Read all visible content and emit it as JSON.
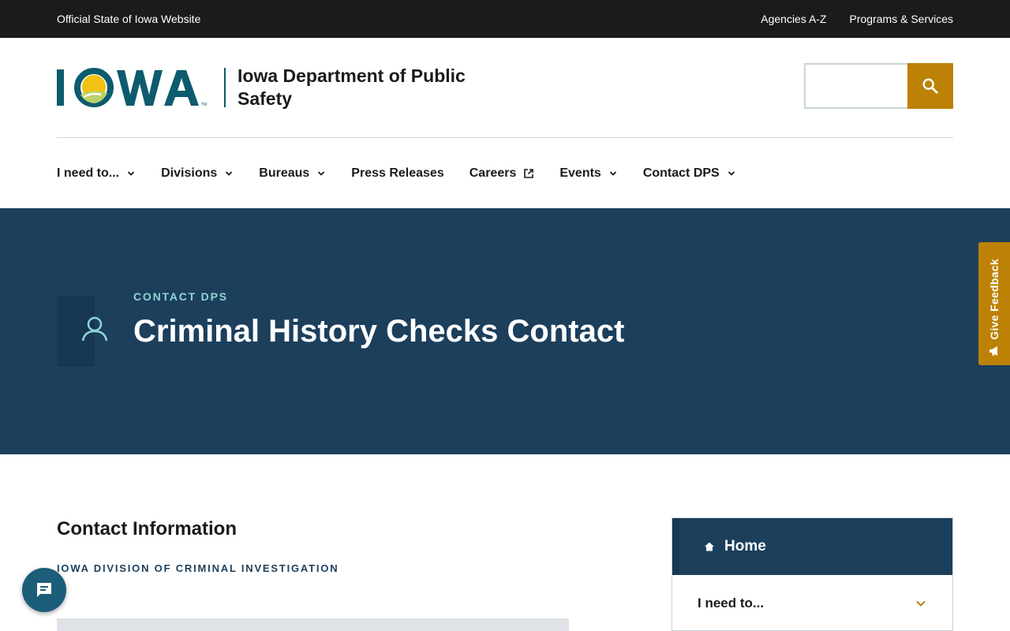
{
  "topbar": {
    "official_label": "Official State of Iowa Website",
    "links": [
      "Agencies A-Z",
      "Programs & Services"
    ]
  },
  "header": {
    "logo_text": "IOWA",
    "department_name": "Iowa Department of Public Safety",
    "search": {
      "placeholder": "",
      "button_icon": "search-icon"
    }
  },
  "nav": {
    "items": [
      {
        "label": "I need to...",
        "has_dropdown": true
      },
      {
        "label": "Divisions",
        "has_dropdown": true
      },
      {
        "label": "Bureaus",
        "has_dropdown": true
      },
      {
        "label": "Press Releases",
        "has_dropdown": false
      },
      {
        "label": "Careers",
        "external": true
      },
      {
        "label": "Events",
        "has_dropdown": true
      },
      {
        "label": "Contact DPS",
        "has_dropdown": true
      }
    ]
  },
  "hero": {
    "eyebrow": "CONTACT DPS",
    "title": "Criminal History Checks Contact",
    "icon": "person-icon"
  },
  "feedback": {
    "label": "Give Feedback",
    "icon": "megaphone-icon"
  },
  "content": {
    "section_title": "Contact Information",
    "division": "IOWA DIVISION OF CRIMINAL INVESTIGATION"
  },
  "sidebar": {
    "home_label": "Home",
    "items": [
      {
        "label": "I need to..."
      }
    ]
  },
  "chat": {
    "icon": "chat-icon"
  },
  "colors": {
    "topbar": "#1b1b1b",
    "hero": "#1c3f5c",
    "accent_gold": "#bd8205",
    "eyebrow_teal": "#8ed6d4",
    "logo_teal": "#0d5b6e"
  }
}
